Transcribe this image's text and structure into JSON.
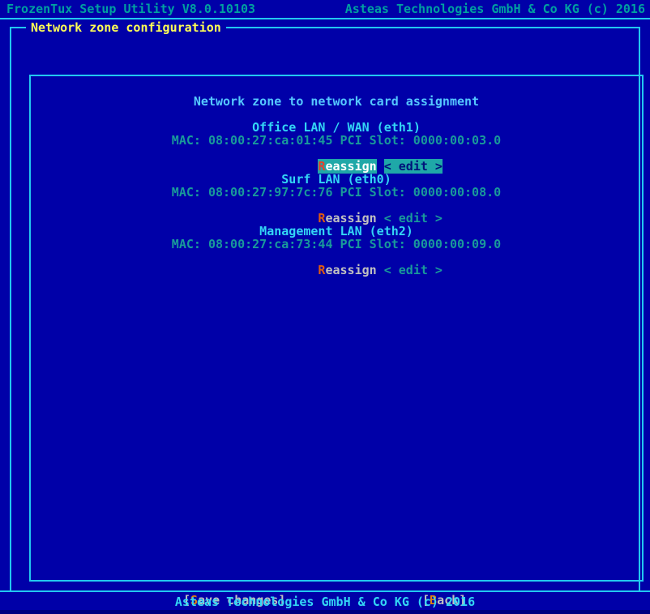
{
  "colors": {
    "background": "#0000a8",
    "border": "#22c8f0",
    "group_title": "#ffff55",
    "header_text": "#00a0a0",
    "zone_title": "#33d6f5",
    "zone_info": "#199a9a",
    "button_text": "#c0c0c0",
    "hotkey": "#e08010",
    "selection_background": "#1fa8a8",
    "selection_text": "#ffffff",
    "footer_text": "#33d6f5"
  },
  "header": {
    "product": "FrozenTux Setup Utility V8.0.10103",
    "vendor": "Asteas Technologies GmbH & Co KG (c) 2016"
  },
  "group": {
    "title": "Network zone configuration"
  },
  "panel": {
    "heading": "Network zone to network card assignment"
  },
  "zones": [
    {
      "title": "Office LAN / WAN (eth1)",
      "info": "MAC: 08:00:27:ca:01:45 PCI Slot: 0000:00:03.0",
      "mac_label": "MAC:",
      "mac": "08:00:27:ca:01:45",
      "pci_label": "PCI Slot:",
      "pci_slot": "0000:00:03.0",
      "reassign_hotkey": "R",
      "reassign_rest": "eassign",
      "edit_label": "< edit >",
      "selected": true
    },
    {
      "title": "Surf LAN (eth0)",
      "info": "MAC: 08:00:27:97:7c:76 PCI Slot: 0000:00:08.0",
      "mac_label": "MAC:",
      "mac": "08:00:27:97:7c:76",
      "pci_label": "PCI Slot:",
      "pci_slot": "0000:00:08.0",
      "reassign_hotkey": "R",
      "reassign_rest": "eassign",
      "edit_label": "< edit >",
      "selected": false
    },
    {
      "title": "Management LAN (eth2)",
      "info": "MAC: 08:00:27:ca:73:44 PCI Slot: 0000:00:09.0",
      "mac_label": "MAC:",
      "mac": "08:00:27:ca:73:44",
      "pci_label": "PCI Slot:",
      "pci_slot": "0000:00:09.0",
      "reassign_hotkey": "R",
      "reassign_rest": "eassign",
      "edit_label": "< edit >",
      "selected": false
    }
  ],
  "buttons": {
    "save": {
      "prefix": "[",
      "hotkey": "S",
      "rest": "ave changes",
      "suffix": "]"
    },
    "back": {
      "prefix": "[",
      "hotkey": "B",
      "rest": "ack",
      "suffix": "]"
    }
  },
  "footer": {
    "text": "Asteas Technologies GmbH & Co KG (c) 2016"
  }
}
